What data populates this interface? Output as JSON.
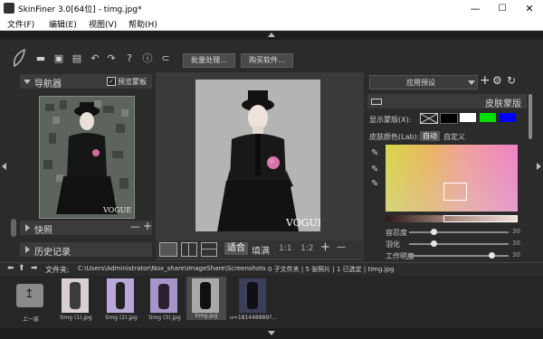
{
  "window": {
    "title": "SkinFiner 3.0[64位] - timg.jpg*",
    "minimize": "—",
    "maximize": "☐",
    "close": "✕"
  },
  "menu": [
    {
      "label": "文件(F)"
    },
    {
      "label": "编辑(E)"
    },
    {
      "label": "视图(V)"
    },
    {
      "label": "帮助(H)"
    }
  ],
  "toolbar": {
    "batch_label": "批量处理...",
    "buy_label": "购买软件...",
    "icons": [
      "logo-leaf-icon",
      "open-folder-icon",
      "save-icon",
      "save-as-icon",
      "undo-icon",
      "redo-icon",
      "help-icon",
      "info-icon",
      "plugin-icon"
    ]
  },
  "left_panel": {
    "navigator_title": "导航器",
    "preview_mask_label": "预览蒙板",
    "preview_mask_checked": true,
    "snapshot_title": "快照",
    "history_title": "历史记录",
    "snapshot_minus": "—",
    "snapshot_plus": "+",
    "vogue_text": "VOGUE"
  },
  "center": {
    "vogue_text": "VOGUE",
    "fit_label": "适合",
    "fill_label": "填满",
    "zoom_1_1": "1:1",
    "zoom_1_2": "1:2",
    "zoom_in": "+",
    "zoom_out": "—"
  },
  "right_panel": {
    "preset_label": "应用预设",
    "section_title": "皮肤蒙版",
    "show_mask_label": "显示蒙版(X):",
    "skin_color_label": "皮肤颜色(Lab):",
    "auto_label": "自动",
    "custom_label": "自定义",
    "tolerance_label": "容忍度",
    "tolerance_value": "30",
    "tolerance_level": 0.25,
    "feather_label": "羽化",
    "feather_value": "30",
    "feather_level": 0.25,
    "third_label": "工作明度",
    "third_value": "30",
    "third_level": 0.8,
    "mask_colors": [
      "#000000",
      "#ffffff",
      "#00e000",
      "#0000ff"
    ]
  },
  "pathbar": {
    "label": "文件夹:",
    "path": "C:\\Users\\Administrator\\Nox_share\\ImageShare\\Screenshots",
    "stats": "0 子文件夹 | 5 张照片 | 1 已选定 | timg.jpg"
  },
  "filmstrip": [
    {
      "label": "上一层",
      "kind": "up"
    },
    {
      "label": "timg (1).jpg",
      "kind": "photo"
    },
    {
      "label": "timg (2).jpg",
      "kind": "photo"
    },
    {
      "label": "timg (3).jpg",
      "kind": "photo"
    },
    {
      "label": "timg.jpg",
      "kind": "photo",
      "selected": true
    },
    {
      "label": "u=181448889?...",
      "kind": "photo"
    }
  ]
}
